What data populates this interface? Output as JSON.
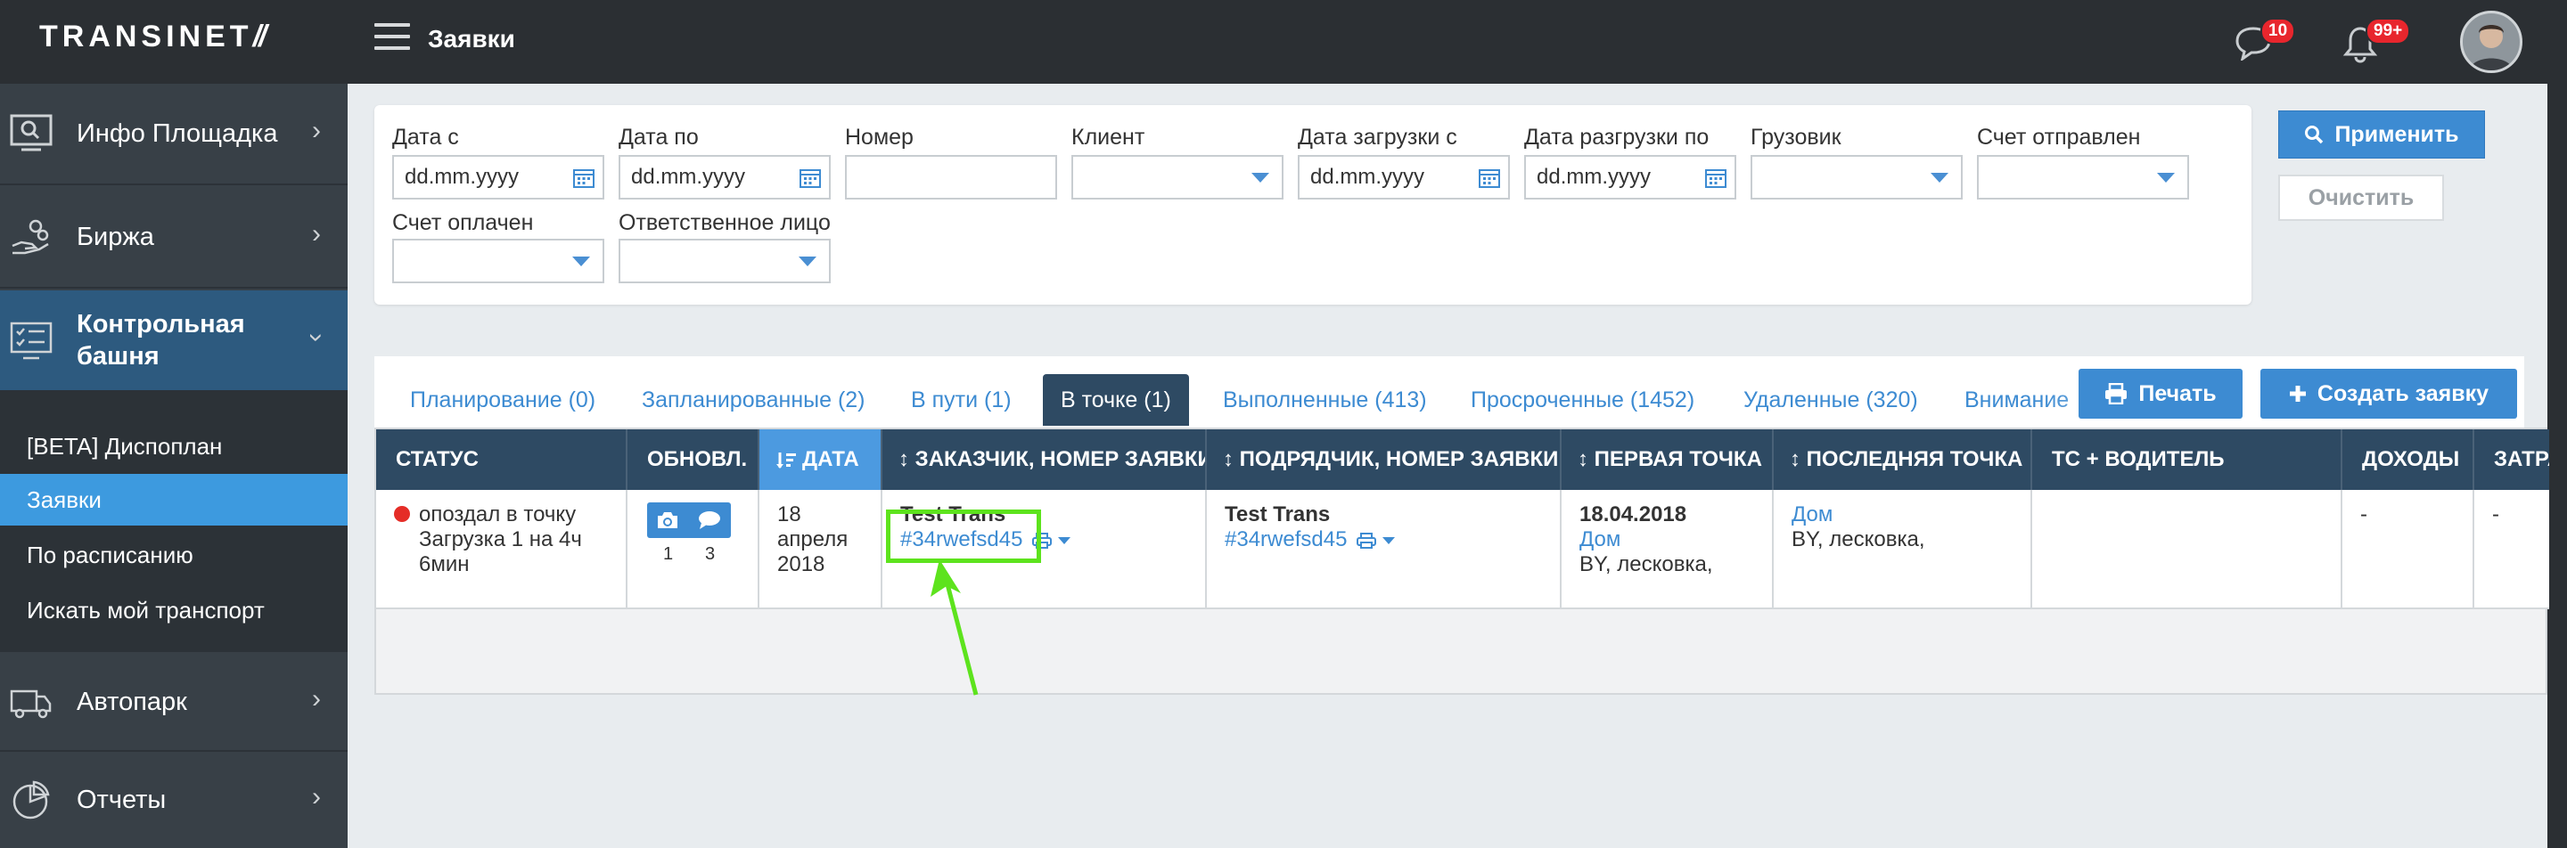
{
  "app": {
    "logo_main": "TRANSINET",
    "logo_slash": "//",
    "page_title": "Заявки"
  },
  "header": {
    "messages_badge": "10",
    "notifications_badge": "99+"
  },
  "sidebar": {
    "items": [
      {
        "label": "Инфо Площадка",
        "icon": "search-monitor-icon"
      },
      {
        "label": "Биржа",
        "icon": "hand-coins-icon"
      },
      {
        "label": "Контрольная башня",
        "icon": "checklist-board-icon"
      },
      {
        "label": "Автопарк",
        "icon": "truck-icon"
      },
      {
        "label": "Отчеты",
        "icon": "pie-chart-icon"
      }
    ],
    "submenu": [
      "[BETA] Диспоплан",
      "Заявки",
      "По расписанию",
      "Искать мой транспорт"
    ]
  },
  "filters": {
    "date_from": {
      "label": "Дата с",
      "placeholder": "dd.mm.yyyy"
    },
    "date_to": {
      "label": "Дата по",
      "placeholder": "dd.mm.yyyy"
    },
    "number": {
      "label": "Номер",
      "value": ""
    },
    "client": {
      "label": "Клиент"
    },
    "load_date": {
      "label": "Дата загрузки с",
      "placeholder": "dd.mm.yyyy"
    },
    "unload_date": {
      "label": "Дата разгрузки по",
      "placeholder": "dd.mm.yyyy"
    },
    "truck": {
      "label": "Грузовик"
    },
    "invoice_sent": {
      "label": "Счет отправлен"
    },
    "invoice_paid": {
      "label": "Счет оплачен"
    },
    "responsible": {
      "label": "Ответственное лицо"
    },
    "apply": "Применить",
    "clear": "Очистить"
  },
  "tabs": [
    "Планирование (0)",
    "Запланированные (2)",
    "В пути (1)",
    "В точке (1)",
    "Выполненные (413)",
    "Просроченные (1452)",
    "Удаленные (320)",
    "Внимание"
  ],
  "actions": {
    "print": "Печать",
    "create": "Создать заявку"
  },
  "table": {
    "columns": [
      "СТАТУС",
      "ОБНОВЛ.",
      "ДАТА",
      "ЗАКАЗЧИК, НОМЕР ЗАЯВКИ",
      "ПОДРЯДЧИК, НОМЕР ЗАЯВКИ",
      "ПЕРВАЯ ТОЧКА",
      "ПОСЛЕДНЯЯ ТОЧКА",
      "ТС + ВОДИТЕЛЬ",
      "ДОХОДЫ",
      "ЗАТРАТ"
    ],
    "row": {
      "status_line1": "опоздал в точку",
      "status_line2": "Загрузка 1 на 4ч",
      "status_line3": "6мин",
      "photos_count": "1",
      "comments_count": "3",
      "date_day": "18",
      "date_month": "апреля",
      "date_year": "2018",
      "customer_name": "Test Trans",
      "customer_order": "#34rwefsd45",
      "contractor_name": "Test Trans",
      "contractor_order": "#34rwefsd45",
      "first_date": "18.04.2018",
      "first_place": "Дом",
      "first_address": "BY, лесковка,",
      "last_place": "Дом",
      "last_address": "BY, лесковка,",
      "vehicle": "",
      "income": "-",
      "expenses": "-"
    }
  }
}
